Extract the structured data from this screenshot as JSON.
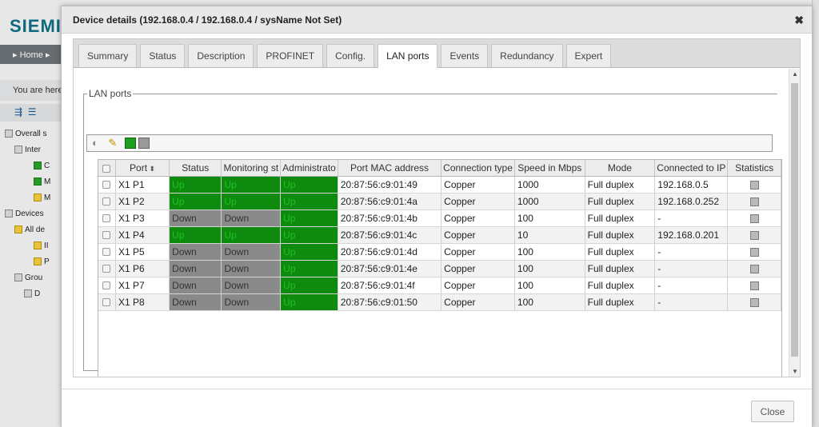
{
  "background": {
    "logo": "SIEMI",
    "nav_home": "▸ Home ▸",
    "you_are_here": "You are here",
    "tree": [
      {
        "label": "Overall s",
        "indent": 0,
        "icon": "leaf"
      },
      {
        "label": "Inter",
        "indent": 1,
        "icon": "leaf"
      },
      {
        "label": "C",
        "indent": 3,
        "icon": "green"
      },
      {
        "label": "M",
        "indent": 3,
        "icon": "green"
      },
      {
        "label": "M",
        "indent": 3,
        "icon": "yellow"
      },
      {
        "label": "Devices",
        "indent": 0,
        "icon": "leaf"
      },
      {
        "label": "All de",
        "indent": 1,
        "icon": "yellow"
      },
      {
        "label": "II",
        "indent": 3,
        "icon": "yellow"
      },
      {
        "label": "P",
        "indent": 3,
        "icon": "yellow"
      },
      {
        "label": "Grou",
        "indent": 1,
        "icon": "leaf"
      },
      {
        "label": "D",
        "indent": 2,
        "icon": "leaf"
      }
    ]
  },
  "dialog": {
    "title": "Device details (192.168.0.4 / 192.168.0.4 / sysName Not Set)",
    "close_symbol": "✖",
    "tabs": [
      "Summary",
      "Status",
      "Description",
      "PROFINET",
      "Config.",
      "LAN ports",
      "Events",
      "Redundancy",
      "Expert"
    ],
    "active_tab": "LAN ports",
    "section_title": "LAN ports",
    "columns": [
      "Port",
      "Status",
      "Monitoring st",
      "Administrato",
      "Port MAC address",
      "Connection type",
      "Speed in Mbps",
      "Mode",
      "Connected to IP",
      "Statistics"
    ],
    "rows": [
      {
        "port": "X1 P1",
        "status": "Up",
        "monitoring": "Up",
        "admin": "Up",
        "mac": "20:87:56:c9:01:49",
        "conn": "Copper",
        "speed": "1000",
        "mode": "Full duplex",
        "ip": "192.168.0.5"
      },
      {
        "port": "X1 P2",
        "status": "Up",
        "monitoring": "Up",
        "admin": "Up",
        "mac": "20:87:56:c9:01:4a",
        "conn": "Copper",
        "speed": "1000",
        "mode": "Full duplex",
        "ip": "192.168.0.252"
      },
      {
        "port": "X1 P3",
        "status": "Down",
        "monitoring": "Down",
        "admin": "Up",
        "mac": "20:87:56:c9:01:4b",
        "conn": "Copper",
        "speed": "100",
        "mode": "Full duplex",
        "ip": "-"
      },
      {
        "port": "X1 P4",
        "status": "Up",
        "monitoring": "Up",
        "admin": "Up",
        "mac": "20:87:56:c9:01:4c",
        "conn": "Copper",
        "speed": "10",
        "mode": "Full duplex",
        "ip": "192.168.0.201"
      },
      {
        "port": "X1 P5",
        "status": "Down",
        "monitoring": "Down",
        "admin": "Up",
        "mac": "20:87:56:c9:01:4d",
        "conn": "Copper",
        "speed": "100",
        "mode": "Full duplex",
        "ip": "-"
      },
      {
        "port": "X1 P6",
        "status": "Down",
        "monitoring": "Down",
        "admin": "Up",
        "mac": "20:87:56:c9:01:4e",
        "conn": "Copper",
        "speed": "100",
        "mode": "Full duplex",
        "ip": "-"
      },
      {
        "port": "X1 P7",
        "status": "Down",
        "monitoring": "Down",
        "admin": "Up",
        "mac": "20:87:56:c9:01:4f",
        "conn": "Copper",
        "speed": "100",
        "mode": "Full duplex",
        "ip": "-"
      },
      {
        "port": "X1 P8",
        "status": "Down",
        "monitoring": "Down",
        "admin": "Up",
        "mac": "20:87:56:c9:01:50",
        "conn": "Copper",
        "speed": "100",
        "mode": "Full duplex",
        "ip": "-"
      }
    ],
    "close_button": "Close",
    "colors": {
      "up": "#0e8a0e",
      "down": "#8a8a8a"
    }
  }
}
